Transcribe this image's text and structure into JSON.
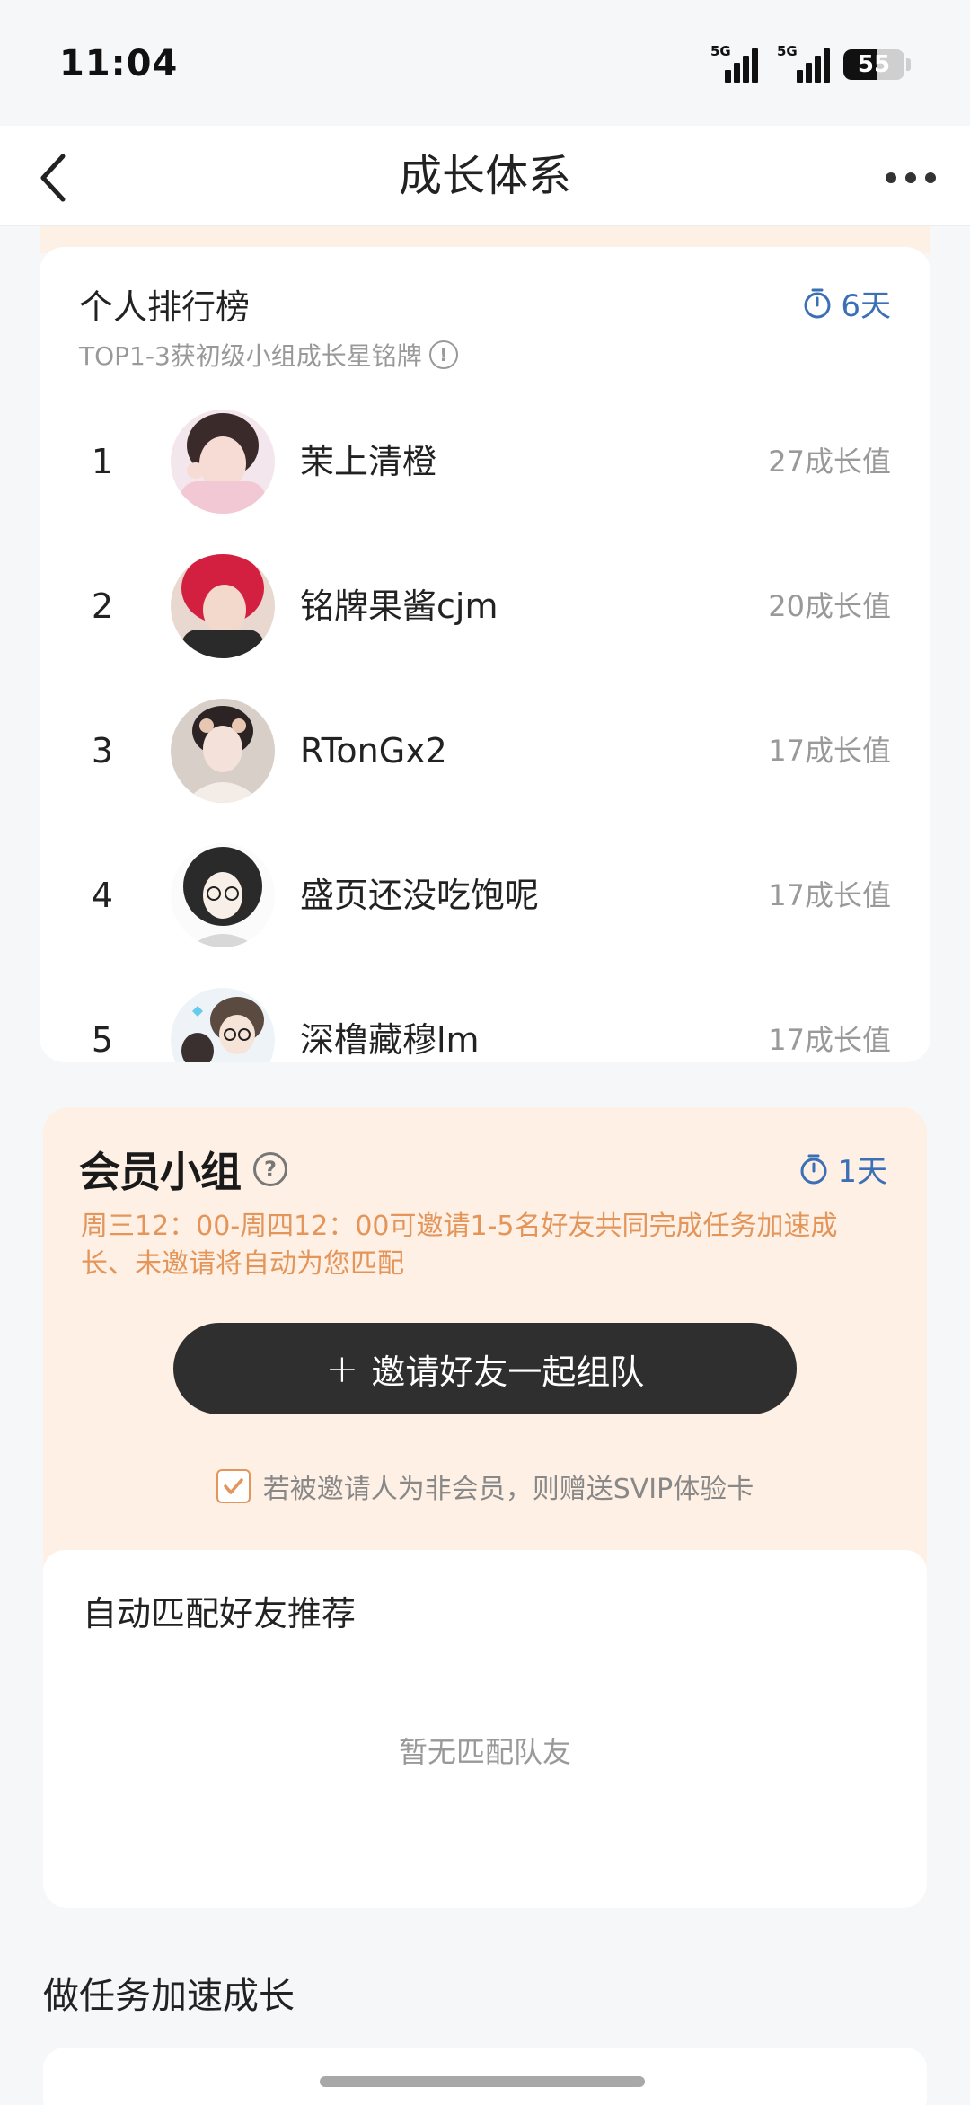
{
  "status_bar": {
    "time": "11:04",
    "network1": "5G",
    "network2": "5G",
    "battery": "55"
  },
  "nav": {
    "title": "成长体系"
  },
  "leaderboard": {
    "title": "个人排行榜",
    "subtitle": "TOP1-3获初级小组成长星铭牌",
    "timer": "6天",
    "rows": [
      {
        "rank": "1",
        "name": "茉上清橙",
        "score": "27成长值"
      },
      {
        "rank": "2",
        "name": "铭牌果酱cjm",
        "score": "20成长值"
      },
      {
        "rank": "3",
        "name": "RTonGx2",
        "score": "17成长值"
      },
      {
        "rank": "4",
        "name": "盛页还没吃饱呢",
        "score": "17成长值"
      },
      {
        "rank": "5",
        "name": "深橹藏穆lm",
        "score": "17成长值"
      }
    ]
  },
  "group": {
    "title": "会员小组",
    "timer": "1天",
    "description": "周三12：00-周四12：00可邀请1-5名好友共同完成任务加速成长、未邀请将自动为您匹配",
    "invite_label": "邀请好友一起组队",
    "gift_text": "若被邀请人为非会员，则赠送SVIP体验卡",
    "match_title": "自动匹配好友推荐",
    "match_empty": "暂无匹配队友"
  },
  "tasks": {
    "title": "做任务加速成长"
  },
  "colors": {
    "accent_blue": "#3b6fb6",
    "orange_text": "#e3955a",
    "peach_bg": "#fef0e4",
    "button_dark": "#2f2f2f"
  }
}
